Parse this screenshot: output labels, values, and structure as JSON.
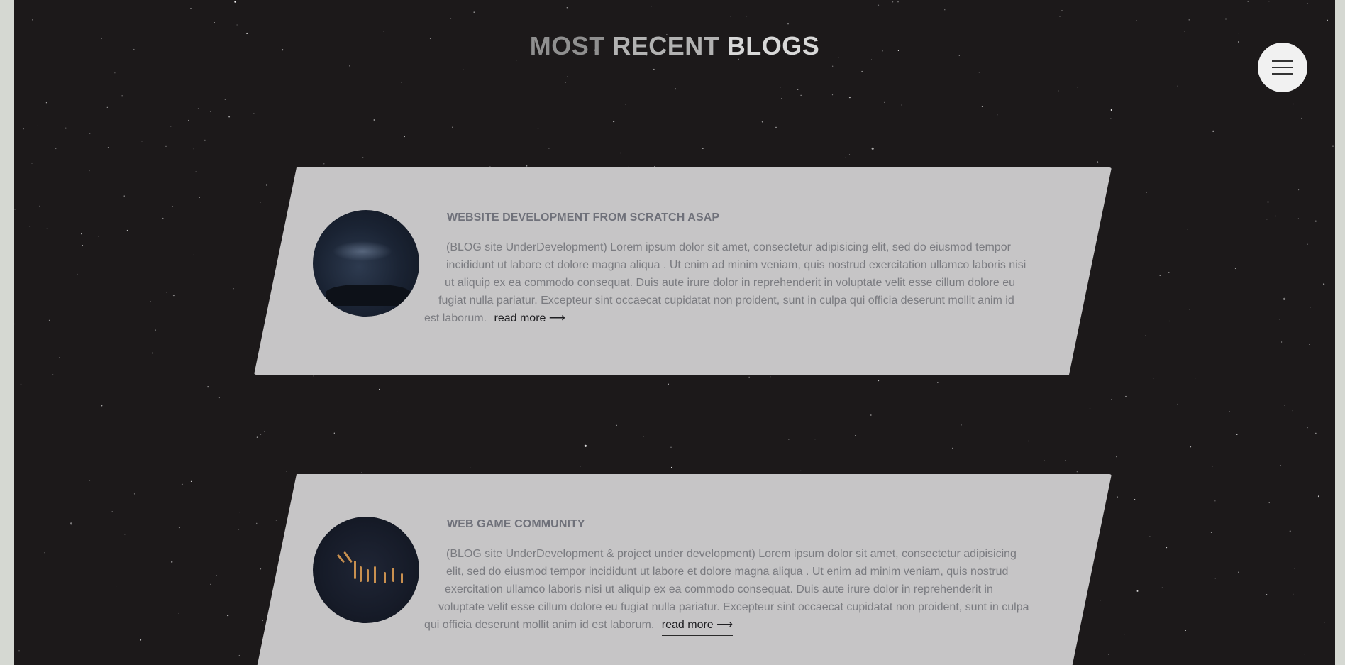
{
  "page": {
    "title_parts": [
      "MOST",
      "RECENT",
      "BLOGS"
    ]
  },
  "menu": {
    "icon": "hamburger-menu-icon"
  },
  "blogs": [
    {
      "title": "WEBSITE DEVELOPMENT FROM SCRATCH ASAP",
      "lines": [
        "(BLOG site UnderDevelopment) Lorem ipsum dolor sit amet, consectetur adipisicing elit, sed do eiusmod tempor",
        "incididunt ut labore et dolore magna aliqua . Ut enim ad minim veniam, quis nostrud exercitation ullamco laboris nisi",
        "ut aliquip ex ea commodo consequat. Duis aute irure dolor in reprehenderit in voluptate velit esse cillum dolore eu",
        "fugiat nulla pariatur. Excepteur sint occaecat cupidatat non proident, sunt in culpa qui officia deserunt mollit anim id",
        "est laborum."
      ],
      "read_more": "read more ⟶",
      "image": "night-sky-mountain-image"
    },
    {
      "title": "WEB GAME COMMUNITY",
      "lines": [
        "(BLOG site UnderDevelopment & project under development) Lorem ipsum dolor sit amet, consectetur adipisicing",
        "elit, sed do eiusmod tempor incididunt ut labore et dolore magna aliqua . Ut enim ad minim veniam, quis nostrud",
        "exercitation ullamco laboris nisi ut aliquip ex ea commodo consequat. Duis aute irure dolor in reprehenderit in",
        "voluptate velit esse cillum dolore eu fugiat nulla pariatur. Excepteur sint occaecat cupidatat non proident, sunt in culpa",
        "qui officia deserunt mollit anim id est laborum."
      ],
      "read_more": "read more ⟶",
      "image": "city-lights-night-image"
    }
  ],
  "colors": {
    "background": "#1c191a",
    "card": "#c6c5c6",
    "title_text": "#6f717a",
    "body_text": "#7a7b80",
    "frame": "#d5d8d2"
  }
}
